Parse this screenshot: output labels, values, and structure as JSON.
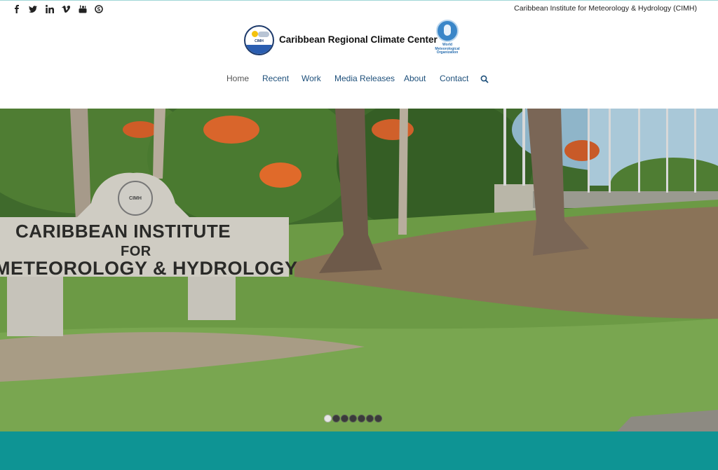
{
  "topbar": {
    "social": [
      {
        "name": "facebook-icon"
      },
      {
        "name": "twitter-icon"
      },
      {
        "name": "linkedin-icon"
      },
      {
        "name": "vimeo-icon"
      },
      {
        "name": "youtube-icon"
      },
      {
        "name": "skype-icon"
      }
    ],
    "org_name": "Caribbean Institute for Meteorology & Hydrology (CIMH)"
  },
  "header": {
    "site_title": "Caribbean Regional Climate Center",
    "cimh_logo_text": "CIMH",
    "wmo_logo_text": "World Meteorological Organization"
  },
  "nav": {
    "items": [
      "Home",
      "Recent",
      "Work",
      "Media Releases",
      "About",
      "Contact"
    ],
    "active": "Home"
  },
  "hero": {
    "sign_line1": "CARIBBEAN INSTITUTE",
    "sign_line2": "FOR",
    "sign_line3": "METEOROLOGY & HYDROLOGY",
    "seal_text": "CIMH",
    "slide_count": 7,
    "active_slide": 1
  },
  "colors": {
    "nav_link": "#1d4f7a",
    "footer_band": "#0e9494"
  }
}
